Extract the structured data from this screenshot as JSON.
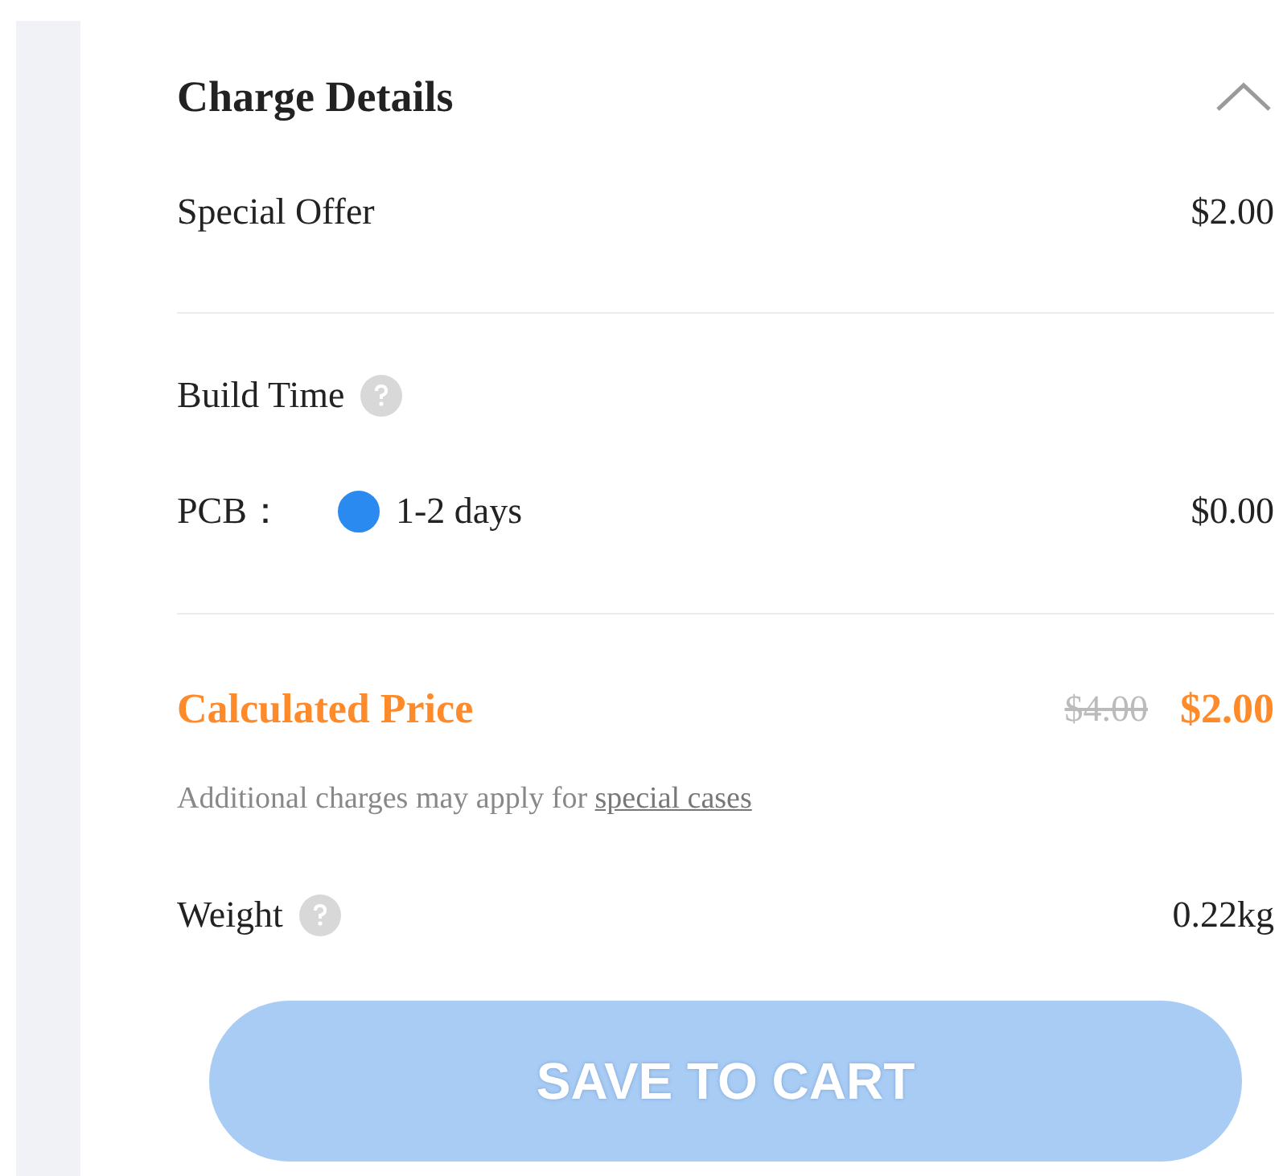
{
  "section": {
    "title": "Charge Details",
    "expanded": true
  },
  "special_offer": {
    "label": "Special Offer",
    "amount": "$2.00"
  },
  "build_time": {
    "label": "Build Time",
    "pcb_label": "PCB：",
    "options": [
      {
        "label": "1-2 days",
        "selected": true
      }
    ],
    "amount": "$0.00"
  },
  "price": {
    "label": "Calculated Price",
    "original": "$4.00",
    "current": "$2.00",
    "note": "Additional charges may apply for ",
    "note_link": "special cases"
  },
  "weight": {
    "label": "Weight",
    "value": "0.22kg"
  },
  "button": {
    "label": "SAVE TO CART",
    "disabled": true
  }
}
